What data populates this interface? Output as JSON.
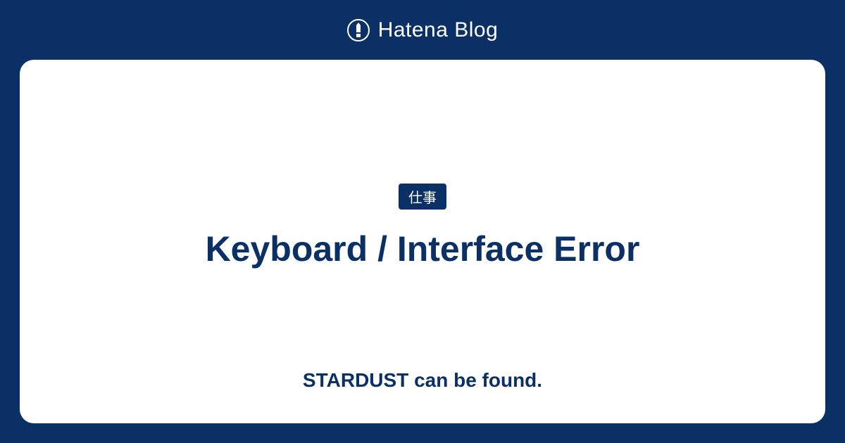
{
  "header": {
    "brand": "Hatena Blog"
  },
  "card": {
    "tag": "仕事",
    "title": "Keyboard / Interface Error",
    "subtitle": "STARDUST can be found."
  },
  "colors": {
    "primary": "#0a3065",
    "card_bg": "#ffffff"
  }
}
